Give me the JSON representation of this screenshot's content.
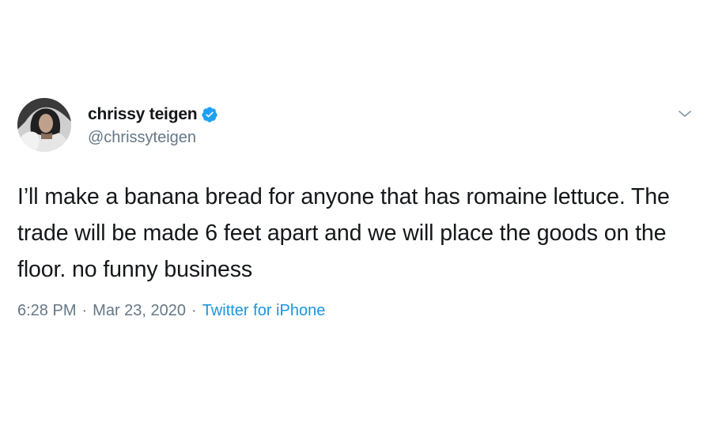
{
  "tweet": {
    "display_name": "chrissy teigen",
    "handle": "@chrissyteigen",
    "verified": true,
    "text": "I’ll make a banana bread for anyone that has romaine lettuce. The trade will be made 6 feet apart and we will place the goods on the floor. no funny business",
    "time": "6:28 PM",
    "separator": "·",
    "date": "Mar 23, 2020",
    "source": "Twitter for iPhone"
  },
  "icons": {
    "verified": "verified-badge-icon",
    "menu": "chevron-down-icon"
  },
  "colors": {
    "text": "#14171a",
    "secondary": "#657786",
    "link": "#1b95e0",
    "verified": "#1da1f2"
  }
}
